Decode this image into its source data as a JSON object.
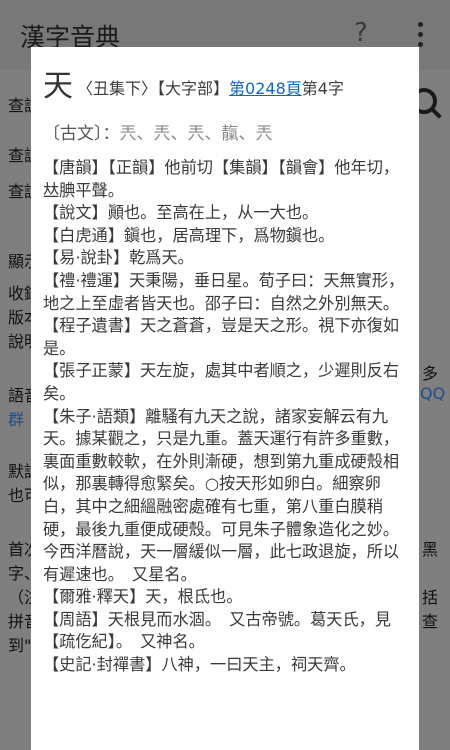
{
  "app_title": "漢字音典",
  "background": {
    "lines": [
      "查訓",
      "查訓",
      "查訓",
      "顯示",
      "收錄",
      "版本",
      "說明",
      "語音",
      "群",
      "默認",
      "也可",
      "首次",
      "字、",
      "（注",
      "拼音",
      "到\""
    ],
    "right_fragments": [
      "多",
      "QQ",
      "黑",
      "括",
      "查"
    ]
  },
  "dialog": {
    "char": "天",
    "volume": "〈丑集下〉",
    "radical": "【大字部】",
    "page_link": "第0248頁",
    "char_index": "第4字",
    "variants_label": "〔古文〕：",
    "variants": "兲、兲、兲、靝、兲",
    "entries": [
      "【唐韻】【正韻】他前切【集韻】【韻會】他年切，𠀤腆平聲。",
      "【說文】顚也。至高在上，从一大也。",
      "【白虎通】鎭也，居高理下，爲物鎭也。",
      "【易·說卦】乾爲天。",
      "【禮·禮運】天秉陽，垂日星。荀子曰：天無實形，地之上至虛者皆天也。邵子曰：自然之外別無天。",
      "【程子遺書】天之蒼蒼，豈是天之形。視下亦復如是。",
      "【張子正蒙】天左旋，處其中者順之，少遲則反右矣。",
      "【朱子·語類】離騷有九天之說，諸家妄解云有九天。據某觀之，只是九重。蓋天運行有許多重數，裏面重數較軟，在外則漸硬，想到第九重成硬殼相似，那裏轉得愈緊矣。○按天形如卵白。細察卵白，其中之細縕融密處確有七重，第八重白膜稍硬，最後九重便成硬殼。可見朱子體象造化之妙。今西洋曆說，天一層緩似一層，此七政退旋，所以有遲速也。　又星名。",
      "【爾雅·釋天】天，根氐也。",
      "【周語】天根見而水涸。　又古帝號。葛天氏，見【疏仡紀】。　又神名。",
      "【史記·封禪書】八神，一曰天主，祠天齊。"
    ]
  }
}
